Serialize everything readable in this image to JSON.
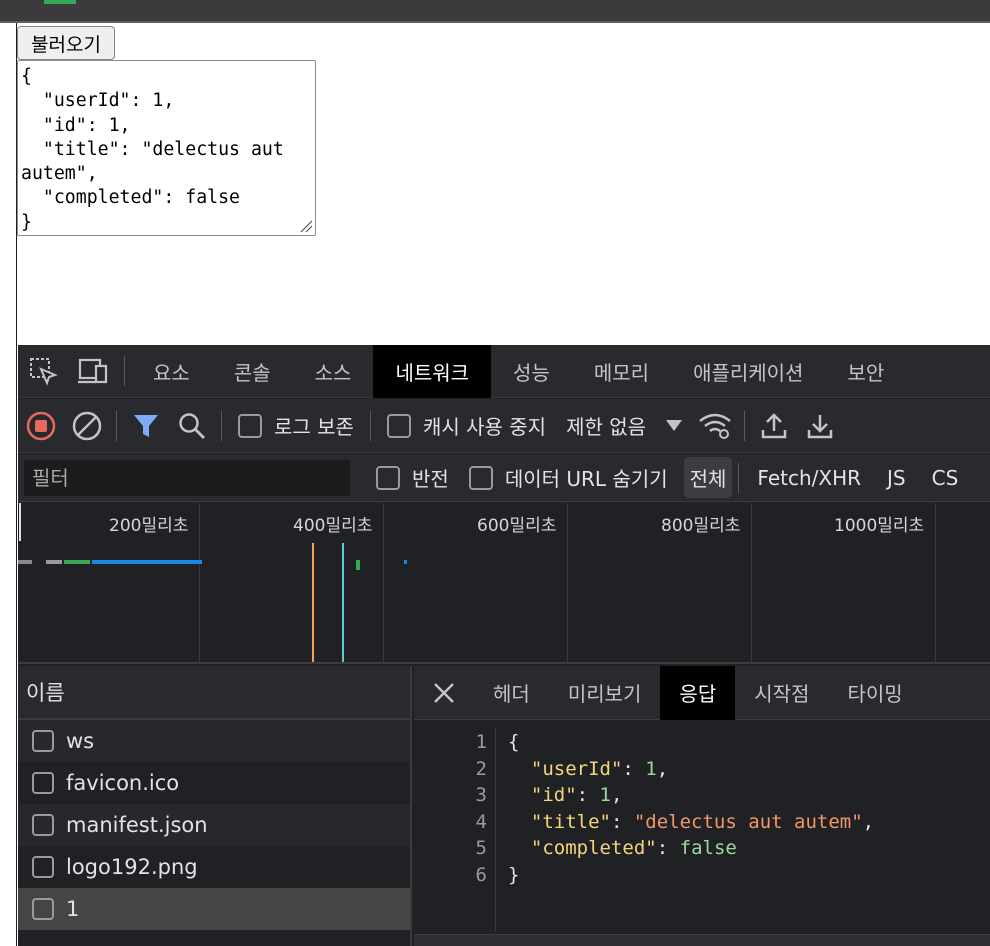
{
  "page": {
    "load_button": "불러오기",
    "json_text": "{\n  \"userId\": 1,\n  \"id\": 1,\n  \"title\": \"delectus aut autem\",\n  \"completed\": false\n}"
  },
  "devtools": {
    "tabs": [
      "요소",
      "콘솔",
      "소스",
      "네트워크",
      "성능",
      "메모리",
      "애플리케이션",
      "보안"
    ],
    "active_tab": "네트워크",
    "toolbar": {
      "preserve_log": "로그 보존",
      "disable_cache": "캐시 사용 중지",
      "throttling": "제한 없음"
    },
    "filter": {
      "placeholder": "필터",
      "invert": "반전",
      "hide_data_urls": "데이터 URL 숨기기",
      "types": [
        "전체",
        "Fetch/XHR",
        "JS",
        "CS"
      ]
    },
    "timeline": {
      "labels": [
        "200밀리초",
        "400밀리초",
        "600밀리초",
        "800밀리초",
        "1000밀리초"
      ]
    },
    "requests": {
      "header": "이름",
      "items": [
        "ws",
        "favicon.ico",
        "manifest.json",
        "logo192.png",
        "1"
      ],
      "selected": "1"
    },
    "detail": {
      "tabs": [
        "헤더",
        "미리보기",
        "응답",
        "시작점",
        "타이밍"
      ],
      "active_tab": "응답",
      "line_numbers": [
        "1",
        "2",
        "3",
        "4",
        "5",
        "6"
      ]
    }
  },
  "colors": {
    "record_stop": "#e8685c",
    "filter_active": "#7cacf8",
    "json_key": "#f5d47b",
    "json_string": "#f29766",
    "json_number": "#9dd89d"
  }
}
